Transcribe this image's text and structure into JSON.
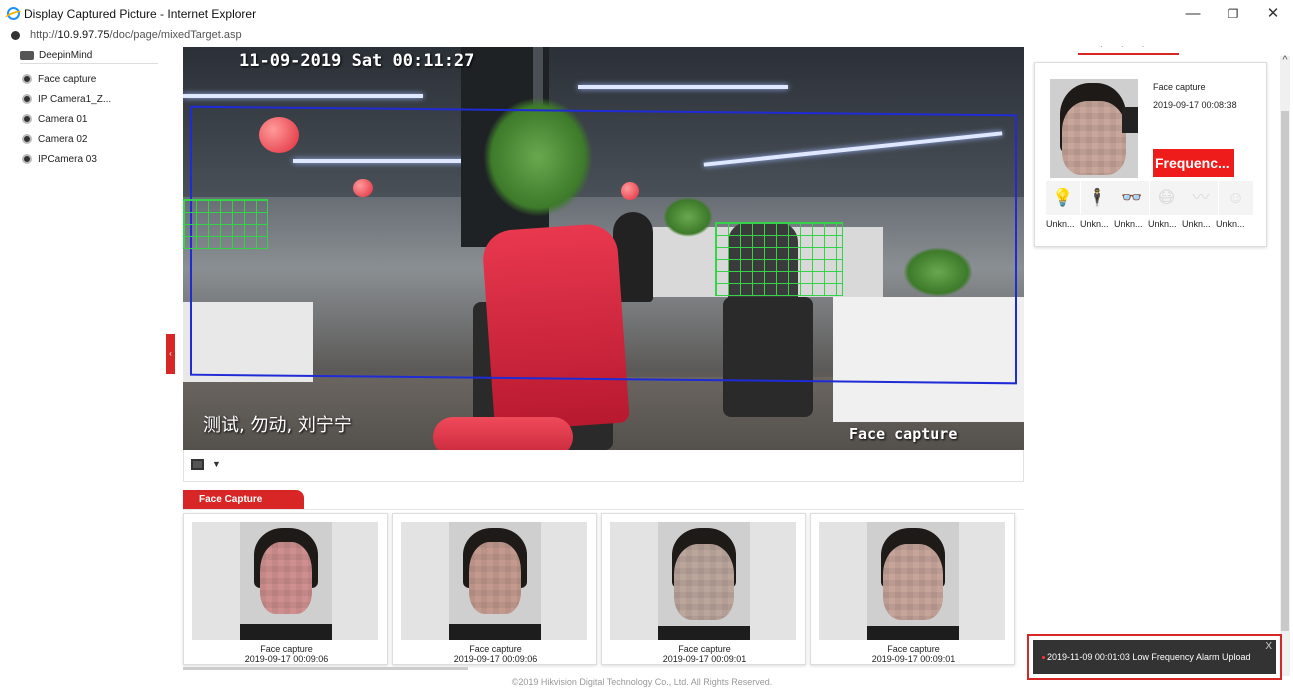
{
  "window": {
    "title": "Display Captured Picture - Internet Explorer",
    "url_prefix": "http://",
    "url_host": "10.9.97.75",
    "url_path": "/doc/page/mixedTarget.asp",
    "minimize_glyph": "—",
    "restore_glyph": "❐",
    "close_glyph": "✕"
  },
  "sidebar": {
    "root": "DeepinMind",
    "items": [
      {
        "label": "Face capture"
      },
      {
        "label": "IP Camera1_Z..."
      },
      {
        "label": "Camera 01"
      },
      {
        "label": "Camera 02"
      },
      {
        "label": "IPCamera 03"
      }
    ],
    "collapse_glyph": "‹"
  },
  "video": {
    "timestamp": "11-09-2019 Sat 00:11:27",
    "overlay_name": "测试, 勿动, 刘宁宁",
    "overlay_channel": "Face capture",
    "layout_caret": "▼"
  },
  "capture_strip": {
    "tab_label": "Face Capture",
    "cards": [
      {
        "label": "Face capture",
        "time": "2019-09-17 00:09:06"
      },
      {
        "label": "Face capture",
        "time": "2019-09-17 00:09:06"
      },
      {
        "label": "Face capture",
        "time": "2019-09-17 00:09:01"
      },
      {
        "label": "Face capture",
        "time": "2019-09-17 00:09:01"
      }
    ]
  },
  "right_panel": {
    "tab_glyph": "· · ·",
    "card": {
      "name": "Face capture",
      "time": "2019-09-17 00:08:38",
      "badge": "Frequenc...",
      "attributes": [
        {
          "icon": "bulb-icon",
          "glyph": "💡",
          "label": "Unkn..."
        },
        {
          "icon": "person-icon",
          "glyph": "🕴",
          "label": "Unkn..."
        },
        {
          "icon": "glasses-icon",
          "glyph": "👓",
          "label": "Unkn..."
        },
        {
          "icon": "mask-icon",
          "glyph": "😷",
          "label": "Unkn..."
        },
        {
          "icon": "mustache-icon",
          "glyph": "〰",
          "label": "Unkn..."
        },
        {
          "icon": "smile-icon",
          "glyph": "☺",
          "label": "Unkn..."
        }
      ]
    }
  },
  "alarm": {
    "text": "2019-11-09 00:01:03 Low Frequency Alarm Upload",
    "close_glyph": "X"
  },
  "footer": {
    "copyright": "©2019 Hikvision Digital Technology Co., Ltd. All Rights Reserved."
  },
  "colors": {
    "accent_red": "#d82626",
    "badge_red": "#ef1c1c",
    "detection_blue": "#1f2bd6",
    "grid_green": "#34d34a"
  }
}
